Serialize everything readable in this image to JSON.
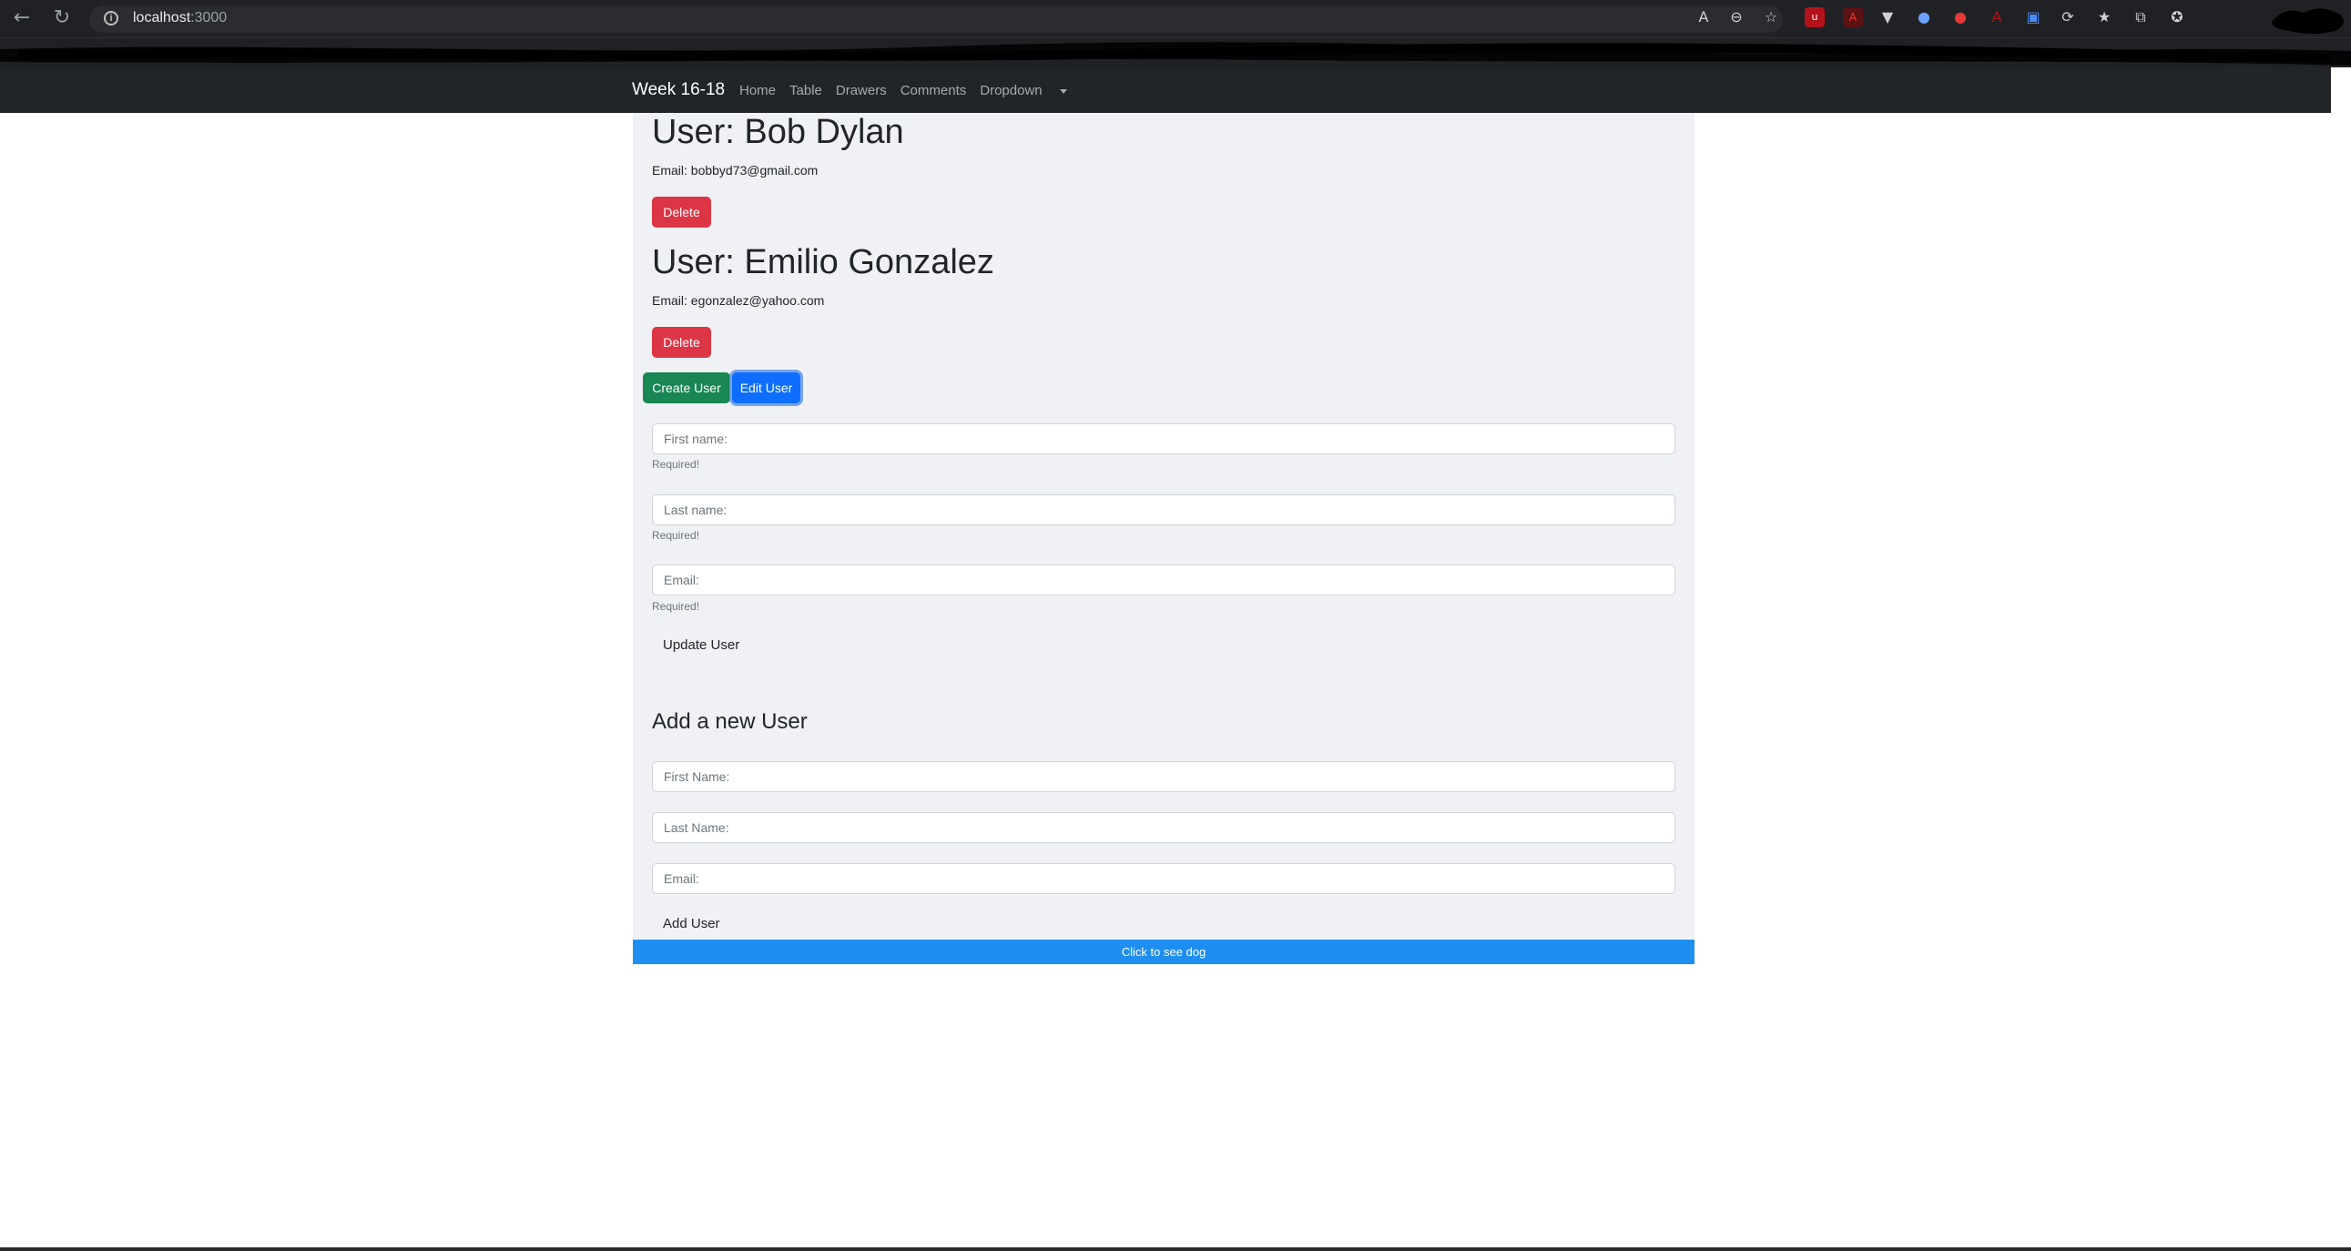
{
  "browser": {
    "url_host": "localhost",
    "url_port": ":3000"
  },
  "navbar": {
    "brand": "Week 16-18",
    "links": [
      "Home",
      "Table",
      "Drawers",
      "Comments",
      "Dropdown"
    ]
  },
  "users": [
    {
      "heading": "User: Bob Dylan",
      "email": "Email: bobbyd73@gmail.com",
      "delete_label": "Delete"
    },
    {
      "heading": "User: Emilio Gonzalez",
      "email": "Email: egonzalez@yahoo.com",
      "delete_label": "Delete"
    }
  ],
  "actions": {
    "create_label": "Create User",
    "edit_label": "Edit User"
  },
  "edit_form": {
    "first_name_placeholder": "First name:",
    "last_name_placeholder": "Last name:",
    "email_placeholder": "Email:",
    "required_hint": "Required!",
    "submit_label": "Update User"
  },
  "add_form": {
    "title": "Add a new User",
    "first_name_placeholder": "First Name:",
    "last_name_placeholder": "Last Name:",
    "email_placeholder": "Email:",
    "submit_label": "Add User"
  },
  "dog_bar": {
    "label": "Click to see dog"
  },
  "colors": {
    "danger": "#dc3545",
    "success": "#198754",
    "primary": "#0d6efd",
    "dog_bar": "#1e8ff0",
    "navbar": "#212529"
  }
}
